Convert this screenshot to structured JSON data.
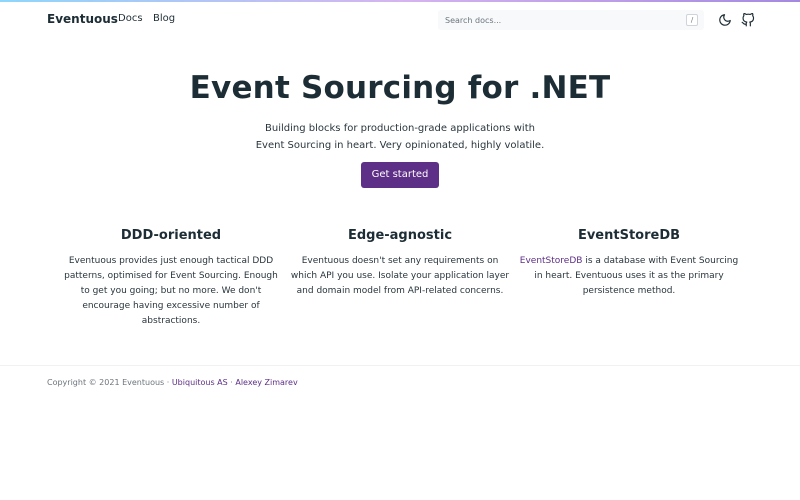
{
  "navbar": {
    "brand": "Eventuous",
    "links": [
      "Docs",
      "Blog"
    ],
    "search_placeholder": "Search docs...",
    "search_shortcut": "/",
    "icons": [
      "moon-icon",
      "github-icon"
    ]
  },
  "hero": {
    "title": "Event Sourcing for .NET",
    "lead": "Building blocks for production-grade applications with Event Sourcing in heart. Very opinionated, highly volatile.",
    "cta_label": "Get started"
  },
  "features": [
    {
      "title": "DDD-oriented",
      "text": "Eventuous provides just enough tactical DDD patterns, optimised for Event Sourcing. Enough to get you going; but no more. We don't encourage having excessive number of abstractions."
    },
    {
      "title": "Edge-agnostic",
      "text": "Eventuous doesn't set any requirements on which API you use. Isolate your application layer and domain model from API-related concerns."
    },
    {
      "title": "EventStoreDB",
      "link_text": "EventStoreDB",
      "text": " is a database with Event Sourcing in heart. Eventuous uses it as the primary persistence method."
    }
  ],
  "footer": {
    "copyright": "Copyright © 2021 Eventuous · ",
    "org_link": "Ubiquitous AS",
    "separator": " · ",
    "author_link": "Alexey Zimarev"
  },
  "colors": {
    "accent": "#5d2f86",
    "text": "#1d2d35",
    "muted": "#6c757d"
  }
}
